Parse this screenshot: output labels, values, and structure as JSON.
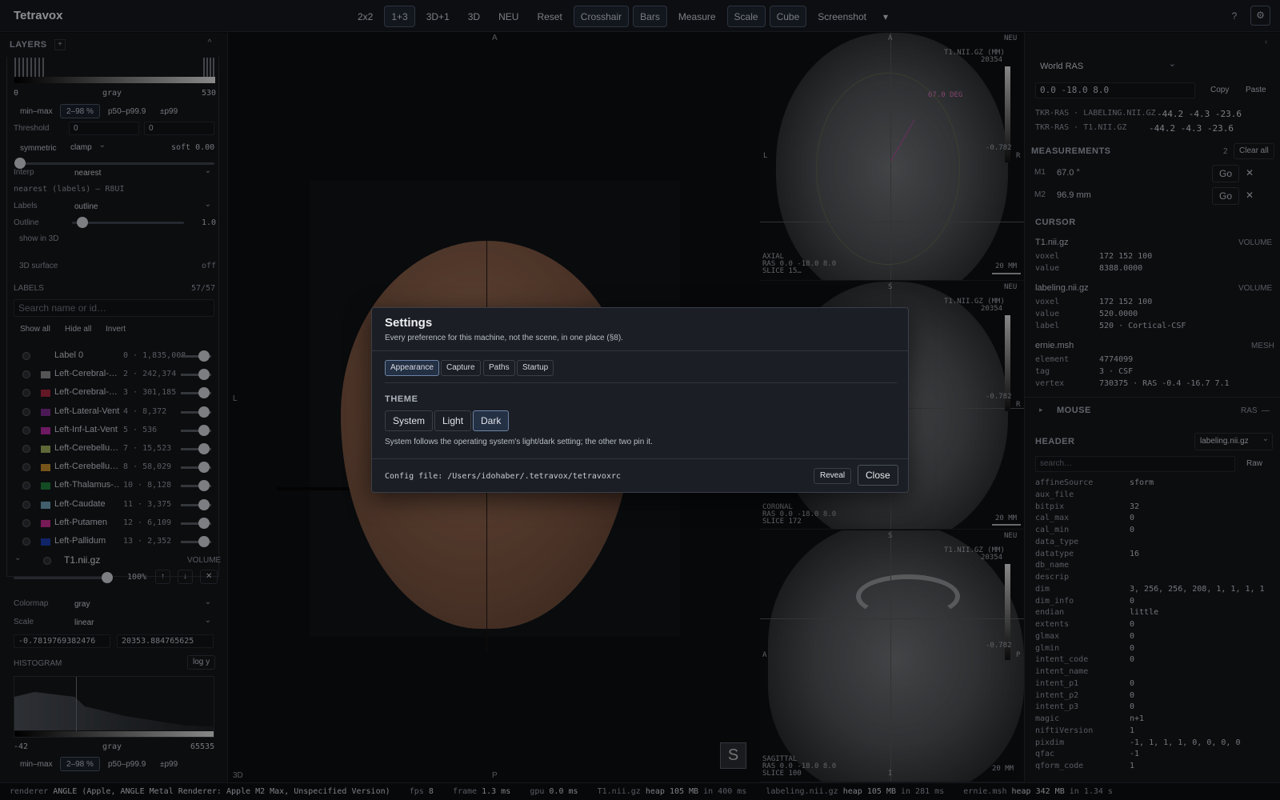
{
  "app": {
    "title": "Tetravox"
  },
  "toolbar": {
    "items": [
      "2x2",
      "1+3",
      "3D+1",
      "3D",
      "NEU",
      "Reset",
      "Crosshair",
      "Bars",
      "Measure",
      "Scale",
      "Cube",
      "Screenshot"
    ],
    "more": "▾"
  },
  "help": "?",
  "gear": "⚙",
  "left": {
    "layers_title": "LAYERS",
    "layers_plus": "+",
    "collapse": "^",
    "hist_top": {
      "min": "0",
      "cmap": "gray",
      "max": "530"
    },
    "pct": [
      "min–max",
      "2–98 %",
      "p50–p99.9",
      "±p99"
    ],
    "threshold": {
      "label": "Threshold",
      "a": "0",
      "b": "0"
    },
    "symmetric": "symmetric",
    "clamp": "clamp",
    "soft": "soft 0.00",
    "interp": {
      "label": "Interp",
      "value": "nearest"
    },
    "interp_note": "nearest (labels) — R8UI",
    "labels_mode": {
      "label": "Labels",
      "value": "outline"
    },
    "outline": {
      "label": "Outline",
      "value": "1.0"
    },
    "show3d": "show in 3D",
    "surface": {
      "label": "3D surface",
      "value": "off"
    },
    "labels_hd": {
      "title": "LABELS",
      "count": "57/57"
    },
    "search_ph": "Search name or id…",
    "btns": [
      "Show all",
      "Hide all",
      "Invert"
    ],
    "rows": [
      {
        "name": "Label 0",
        "count": "0 · 1,835,008",
        "color": ""
      },
      {
        "name": "Left-Cerebral-…",
        "count": "2 · 242,374",
        "color": "#8a8a8a"
      },
      {
        "name": "Left-Cerebral-…",
        "count": "3 · 301,185",
        "color": "#a0283c"
      },
      {
        "name": "Left-Lateral-Vent…",
        "count": "4 · 8,372",
        "color": "#7a2a8a"
      },
      {
        "name": "Left-Inf-Lat-Vent",
        "count": "5 · 536",
        "color": "#b02aa0"
      },
      {
        "name": "Left-Cerebellu…",
        "count": "7 · 15,523",
        "color": "#9aa85a"
      },
      {
        "name": "Left-Cerebellu…",
        "count": "8 · 58,029",
        "color": "#c08a2a"
      },
      {
        "name": "Left-Thalamus-…",
        "count": "10 · 8,128",
        "color": "#1f7a3a"
      },
      {
        "name": "Left-Caudate",
        "count": "11 · 3,375",
        "color": "#6a9ab0"
      },
      {
        "name": "Left-Putamen",
        "count": "12 · 6,109",
        "color": "#c02a8a"
      },
      {
        "name": "Left-Pallidum",
        "count": "13 · 2,352",
        "color": "#1a3aa8"
      }
    ],
    "vol": {
      "name": "T1.nii.gz",
      "kind": "VOLUME",
      "opacity": "100%",
      "up": "↑",
      "down": "↓",
      "x": "✕"
    },
    "colormap": {
      "label": "Colormap",
      "value": "gray"
    },
    "scale": {
      "label": "Scale",
      "value": "linear"
    },
    "range": {
      "min": "-0.7819769382476",
      "max": "20353.884765625"
    },
    "histogram": {
      "title": "HISTOGRAM",
      "log": "log y",
      "min": "-42",
      "cmap": "gray",
      "max": "65535"
    },
    "pct2": [
      "min–max",
      "2–98 %",
      "p50–p99.9",
      "±p99"
    ]
  },
  "view3d": {
    "top": "A",
    "bottom": "P",
    "left": "L",
    "corner": "3D",
    "s": "S"
  },
  "axial": {
    "tag": "NEU",
    "vol": "T1.NII.GZ (MM)",
    "max": "20354",
    "min": "-0.782",
    "top": "A",
    "left": "L",
    "right": "R",
    "angle": "67.0 DEG",
    "info": [
      "AXIAL",
      "RAS 0.0 -18.0 8.0",
      "SLICE 15…"
    ],
    "scale": "20 MM"
  },
  "coronal": {
    "tag": "NEU",
    "vol": "T1.NII.GZ (MM)",
    "max": "20354",
    "min": "-0.782",
    "top": "S",
    "right": "R",
    "info": [
      "CORONAL",
      "RAS 0.0 -18.0 8.0",
      "SLICE 172"
    ],
    "scale": "20 MM"
  },
  "sagittal": {
    "tag": "NEU",
    "vol": "T1.NII.GZ (MM)",
    "max": "20354",
    "min": "-0.782",
    "top": "S",
    "left": "A",
    "right": "P",
    "bottom": "I",
    "info": [
      "SAGITTAL",
      "RAS 0.0 -18.0 8.0",
      "SLICE 100"
    ],
    "scale": "20 MM"
  },
  "right": {
    "coord_sys": "World RAS",
    "coord": "0.0 -18.0 8.0",
    "copy": "Copy",
    "paste": "Paste",
    "tkr": [
      {
        "k": "TKR-RAS · LABELING.NII.GZ",
        "v": "-44.2 -4.3 -23.6"
      },
      {
        "k": "TKR-RAS · T1.NII.GZ",
        "v": "-44.2 -4.3 -23.6"
      }
    ],
    "meas": {
      "title": "MEASUREMENTS",
      "count": "2",
      "clear": "Clear all",
      "items": [
        {
          "id": "M1",
          "val": "67.0 °",
          "go": "Go",
          "x": "✕"
        },
        {
          "id": "M2",
          "val": "96.9 mm",
          "go": "Go",
          "x": "✕"
        }
      ]
    },
    "cursor": {
      "title": "CURSOR",
      "t1": {
        "name": "T1.nii.gz",
        "kind": "VOLUME",
        "voxel_k": "voxel",
        "voxel": "172 152 100",
        "value_k": "value",
        "value": "8388.0000"
      },
      "lab": {
        "name": "labeling.nii.gz",
        "kind": "VOLUME",
        "voxel_k": "voxel",
        "voxel": "172 152 100",
        "value_k": "value",
        "value": "520.0000",
        "label_k": "label",
        "label": "520 · Cortical-CSF"
      },
      "mesh": {
        "name": "ernie.msh",
        "kind": "MESH",
        "el_k": "element",
        "el": "4774099",
        "tag_k": "tag",
        "tag": "3 · CSF",
        "vx_k": "vertex",
        "vx": "730375 · RAS -0.4 -16.7 7.1"
      }
    },
    "mouse": {
      "title": "MOUSE",
      "ras": "RAS",
      "dash": "—"
    },
    "header": {
      "title": "HEADER",
      "file": "labeling.nii.gz",
      "search_ph": "search…",
      "raw": "Raw",
      "rows": [
        [
          "affineSource",
          "sform"
        ],
        [
          "aux_file",
          ""
        ],
        [
          "bitpix",
          "32"
        ],
        [
          "cal_max",
          "0"
        ],
        [
          "cal_min",
          "0"
        ],
        [
          "data_type",
          ""
        ],
        [
          "datatype",
          "16"
        ],
        [
          "db_name",
          ""
        ],
        [
          "descrip",
          ""
        ],
        [
          "dim",
          "3, 256, 256, 208, 1, 1, 1, 1"
        ],
        [
          "dim_info",
          "0"
        ],
        [
          "endian",
          "little"
        ],
        [
          "extents",
          "0"
        ],
        [
          "glmax",
          "0"
        ],
        [
          "glmin",
          "0"
        ],
        [
          "intent_code",
          "0"
        ],
        [
          "intent_name",
          ""
        ],
        [
          "intent_p1",
          "0"
        ],
        [
          "intent_p2",
          "0"
        ],
        [
          "intent_p3",
          "0"
        ],
        [
          "magic",
          "n+1"
        ],
        [
          "niftiVersion",
          "1"
        ],
        [
          "pixdim",
          "-1, 1, 1, 1, 0, 0, 0, 0"
        ],
        [
          "qfac",
          "-1"
        ],
        [
          "qform_code",
          "1"
        ]
      ]
    }
  },
  "status": {
    "renderer_k": "renderer",
    "renderer": "ANGLE (Apple, ANGLE Metal Renderer: Apple M2 Max, Unspecified Version)",
    "fps_k": "fps",
    "fps": "8",
    "frame_k": "frame",
    "frame": "1.3 ms",
    "gpu_k": "gpu",
    "gpu": "0.0 ms",
    "h1": "T1.nii.gz",
    "h1b": "heap 105 MB",
    "h1c": "in 400 ms",
    "h2": "labeling.nii.gz",
    "h2b": "heap 105 MB",
    "h2c": "in 281 ms",
    "h3": "ernie.msh",
    "h3b": "heap 342 MB",
    "h3c": "in 1.34 s"
  },
  "modal": {
    "title": "Settings",
    "subtitle": "Every preference for this machine, not the scene, in one place (§8).",
    "tabs": [
      "Appearance",
      "Capture",
      "Paths",
      "Startup"
    ],
    "theme_heading": "THEME",
    "themes": [
      "System",
      "Light",
      "Dark"
    ],
    "theme_note": "System follows the operating system's light/dark setting; the other two pin it.",
    "config": "Config file: /Users/idohaber/.tetravox/tetravoxrc",
    "reveal": "Reveal",
    "close": "Close"
  }
}
